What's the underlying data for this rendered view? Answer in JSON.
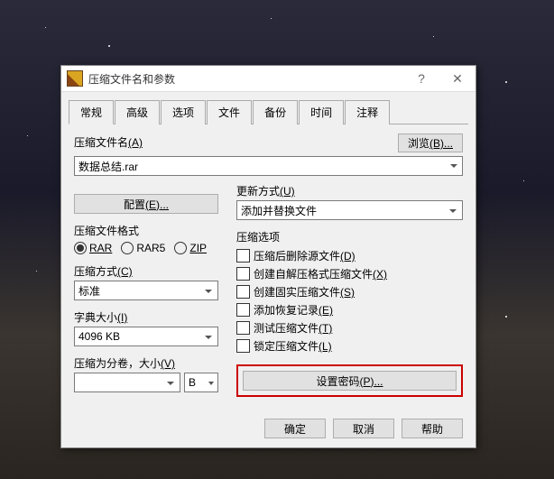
{
  "window": {
    "title": "压缩文件名和参数"
  },
  "tabs": [
    "常规",
    "高级",
    "选项",
    "文件",
    "备份",
    "时间",
    "注释"
  ],
  "archive_name": {
    "label": "压缩文件名",
    "accel": "(A)",
    "value": "数据总结.rar"
  },
  "browse": {
    "label": "浏览",
    "accel": "(B)..."
  },
  "update_mode": {
    "label": "更新方式",
    "accel": "(U)",
    "value": "添加并替换文件"
  },
  "config_btn": {
    "label": "配置",
    "accel": "(E)..."
  },
  "format": {
    "label": "压缩文件格式",
    "options": [
      "RAR",
      "RAR5",
      "ZIP"
    ],
    "selected": 0
  },
  "method": {
    "label": "压缩方式",
    "accel": "(C)",
    "value": "标准"
  },
  "dict": {
    "label": "字典大小",
    "accel": "(I)",
    "value": "4096 KB"
  },
  "split": {
    "label": "压缩为分卷，大小",
    "accel": "(V)",
    "unit": "B"
  },
  "options": {
    "label": "压缩选项",
    "items": [
      {
        "label": "压缩后删除源文件",
        "accel": "(D)"
      },
      {
        "label": "创建自解压格式压缩文件",
        "accel": "(X)"
      },
      {
        "label": "创建固实压缩文件",
        "accel": "(S)"
      },
      {
        "label": "添加恢复记录",
        "accel": "(E)"
      },
      {
        "label": "测试压缩文件",
        "accel": "(T)"
      },
      {
        "label": "锁定压缩文件",
        "accel": "(L)"
      }
    ]
  },
  "password_btn": {
    "label": "设置密码",
    "accel": "(P)..."
  },
  "footer": {
    "ok": "确定",
    "cancel": "取消",
    "help": "帮助"
  }
}
